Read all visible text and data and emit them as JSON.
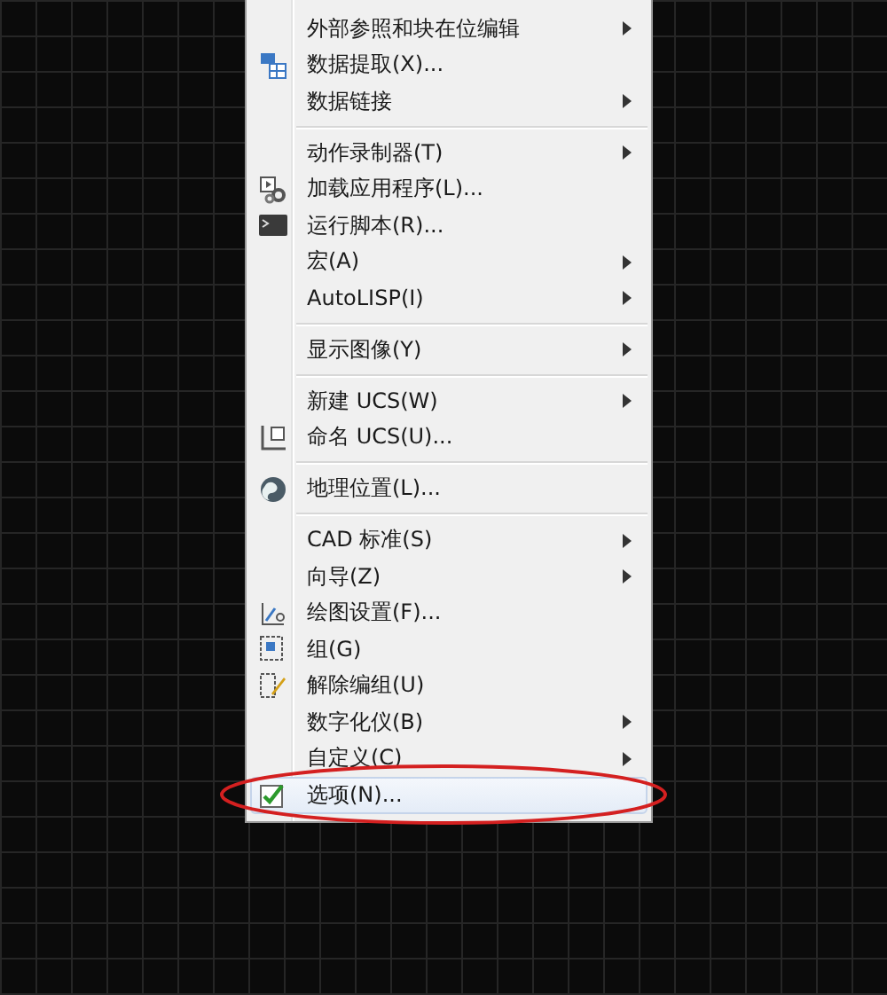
{
  "menu": {
    "groups": [
      {
        "items": [
          {
            "label": "外部参照和块在位编辑",
            "submenu": true,
            "selected": false
          },
          {
            "label": "数据提取(X)...",
            "submenu": false,
            "selected": false,
            "kind": "table"
          },
          {
            "label": "数据链接",
            "submenu": true,
            "selected": false
          }
        ]
      },
      {
        "items": [
          {
            "label": "动作录制器(T)",
            "submenu": true,
            "selected": false
          },
          {
            "label": "加载应用程序(L)...",
            "submenu": false,
            "selected": false,
            "kind": "gears"
          },
          {
            "label": "运行脚本(R)...",
            "submenu": false,
            "selected": false,
            "kind": "terminal"
          },
          {
            "label": "宏(A)",
            "submenu": true,
            "selected": false
          },
          {
            "label": "AutoLISP(I)",
            "submenu": true,
            "selected": false
          }
        ]
      },
      {
        "items": [
          {
            "label": "显示图像(Y)",
            "submenu": true,
            "selected": false
          }
        ]
      },
      {
        "items": [
          {
            "label": "新建 UCS(W)",
            "submenu": true,
            "selected": false
          },
          {
            "label": "命名 UCS(U)...",
            "submenu": false,
            "selected": false,
            "kind": "axes"
          }
        ]
      },
      {
        "items": [
          {
            "label": "地理位置(L)...",
            "submenu": false,
            "selected": false,
            "kind": "globe"
          }
        ]
      },
      {
        "items": [
          {
            "label": "CAD 标准(S)",
            "submenu": true,
            "selected": false
          },
          {
            "label": "向导(Z)",
            "submenu": true,
            "selected": false
          },
          {
            "label": "绘图设置(F)...",
            "submenu": false,
            "selected": false,
            "kind": "drafting"
          },
          {
            "label": "组(G)",
            "submenu": false,
            "selected": false,
            "kind": "group"
          },
          {
            "label": "解除编组(U)",
            "submenu": false,
            "selected": false,
            "kind": "pencil"
          },
          {
            "label": "数字化仪(B)",
            "submenu": true,
            "selected": false
          },
          {
            "label": "自定义(C)",
            "submenu": true,
            "selected": false
          },
          {
            "label": "选项(N)...",
            "submenu": false,
            "selected": true,
            "kind": "check"
          }
        ]
      }
    ]
  },
  "annotations": [
    {
      "kind": "ellipse"
    }
  ]
}
